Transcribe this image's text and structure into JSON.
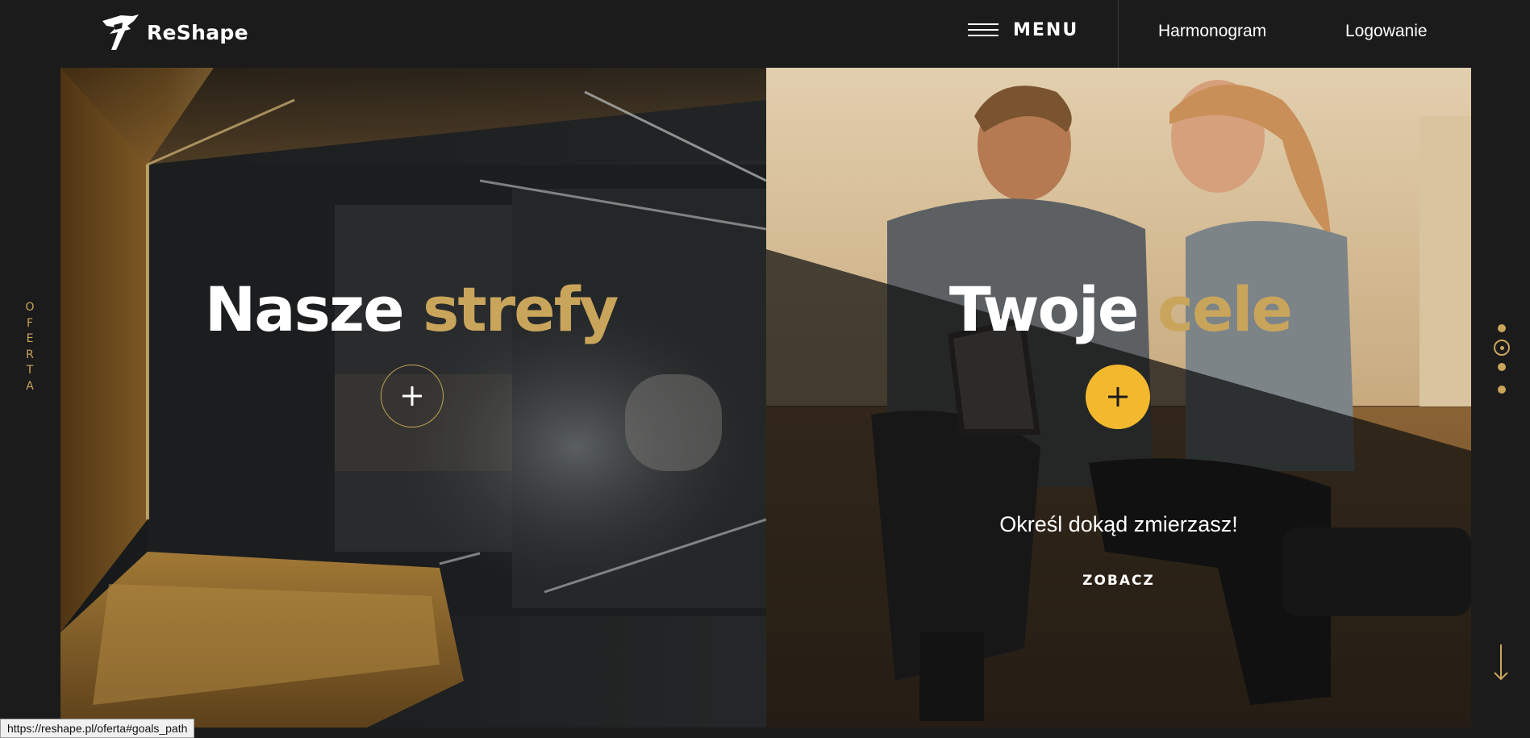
{
  "header": {
    "brand_name": "ReShape",
    "menu_label": "MENU",
    "nav": [
      "Harmonogram",
      "Logowanie"
    ]
  },
  "side": {
    "label_letters": [
      "O",
      "F",
      "E",
      "R",
      "T",
      "A"
    ],
    "pager": {
      "count": 4,
      "active_index": 1
    }
  },
  "panels": {
    "left": {
      "title_white": "Nasze",
      "title_gold": "strefy"
    },
    "right": {
      "title_white": "Twoje",
      "title_gold": "cele",
      "subtitle": "Określ dokąd zmierzasz!",
      "cta": "ZOBACZ"
    }
  },
  "status_bar": {
    "url": "https://reshape.pl/oferta#goals_path"
  },
  "colors": {
    "background": "#1b1b1b",
    "accent_gold": "#c9a55b",
    "button_yellow": "#f3b92e"
  }
}
